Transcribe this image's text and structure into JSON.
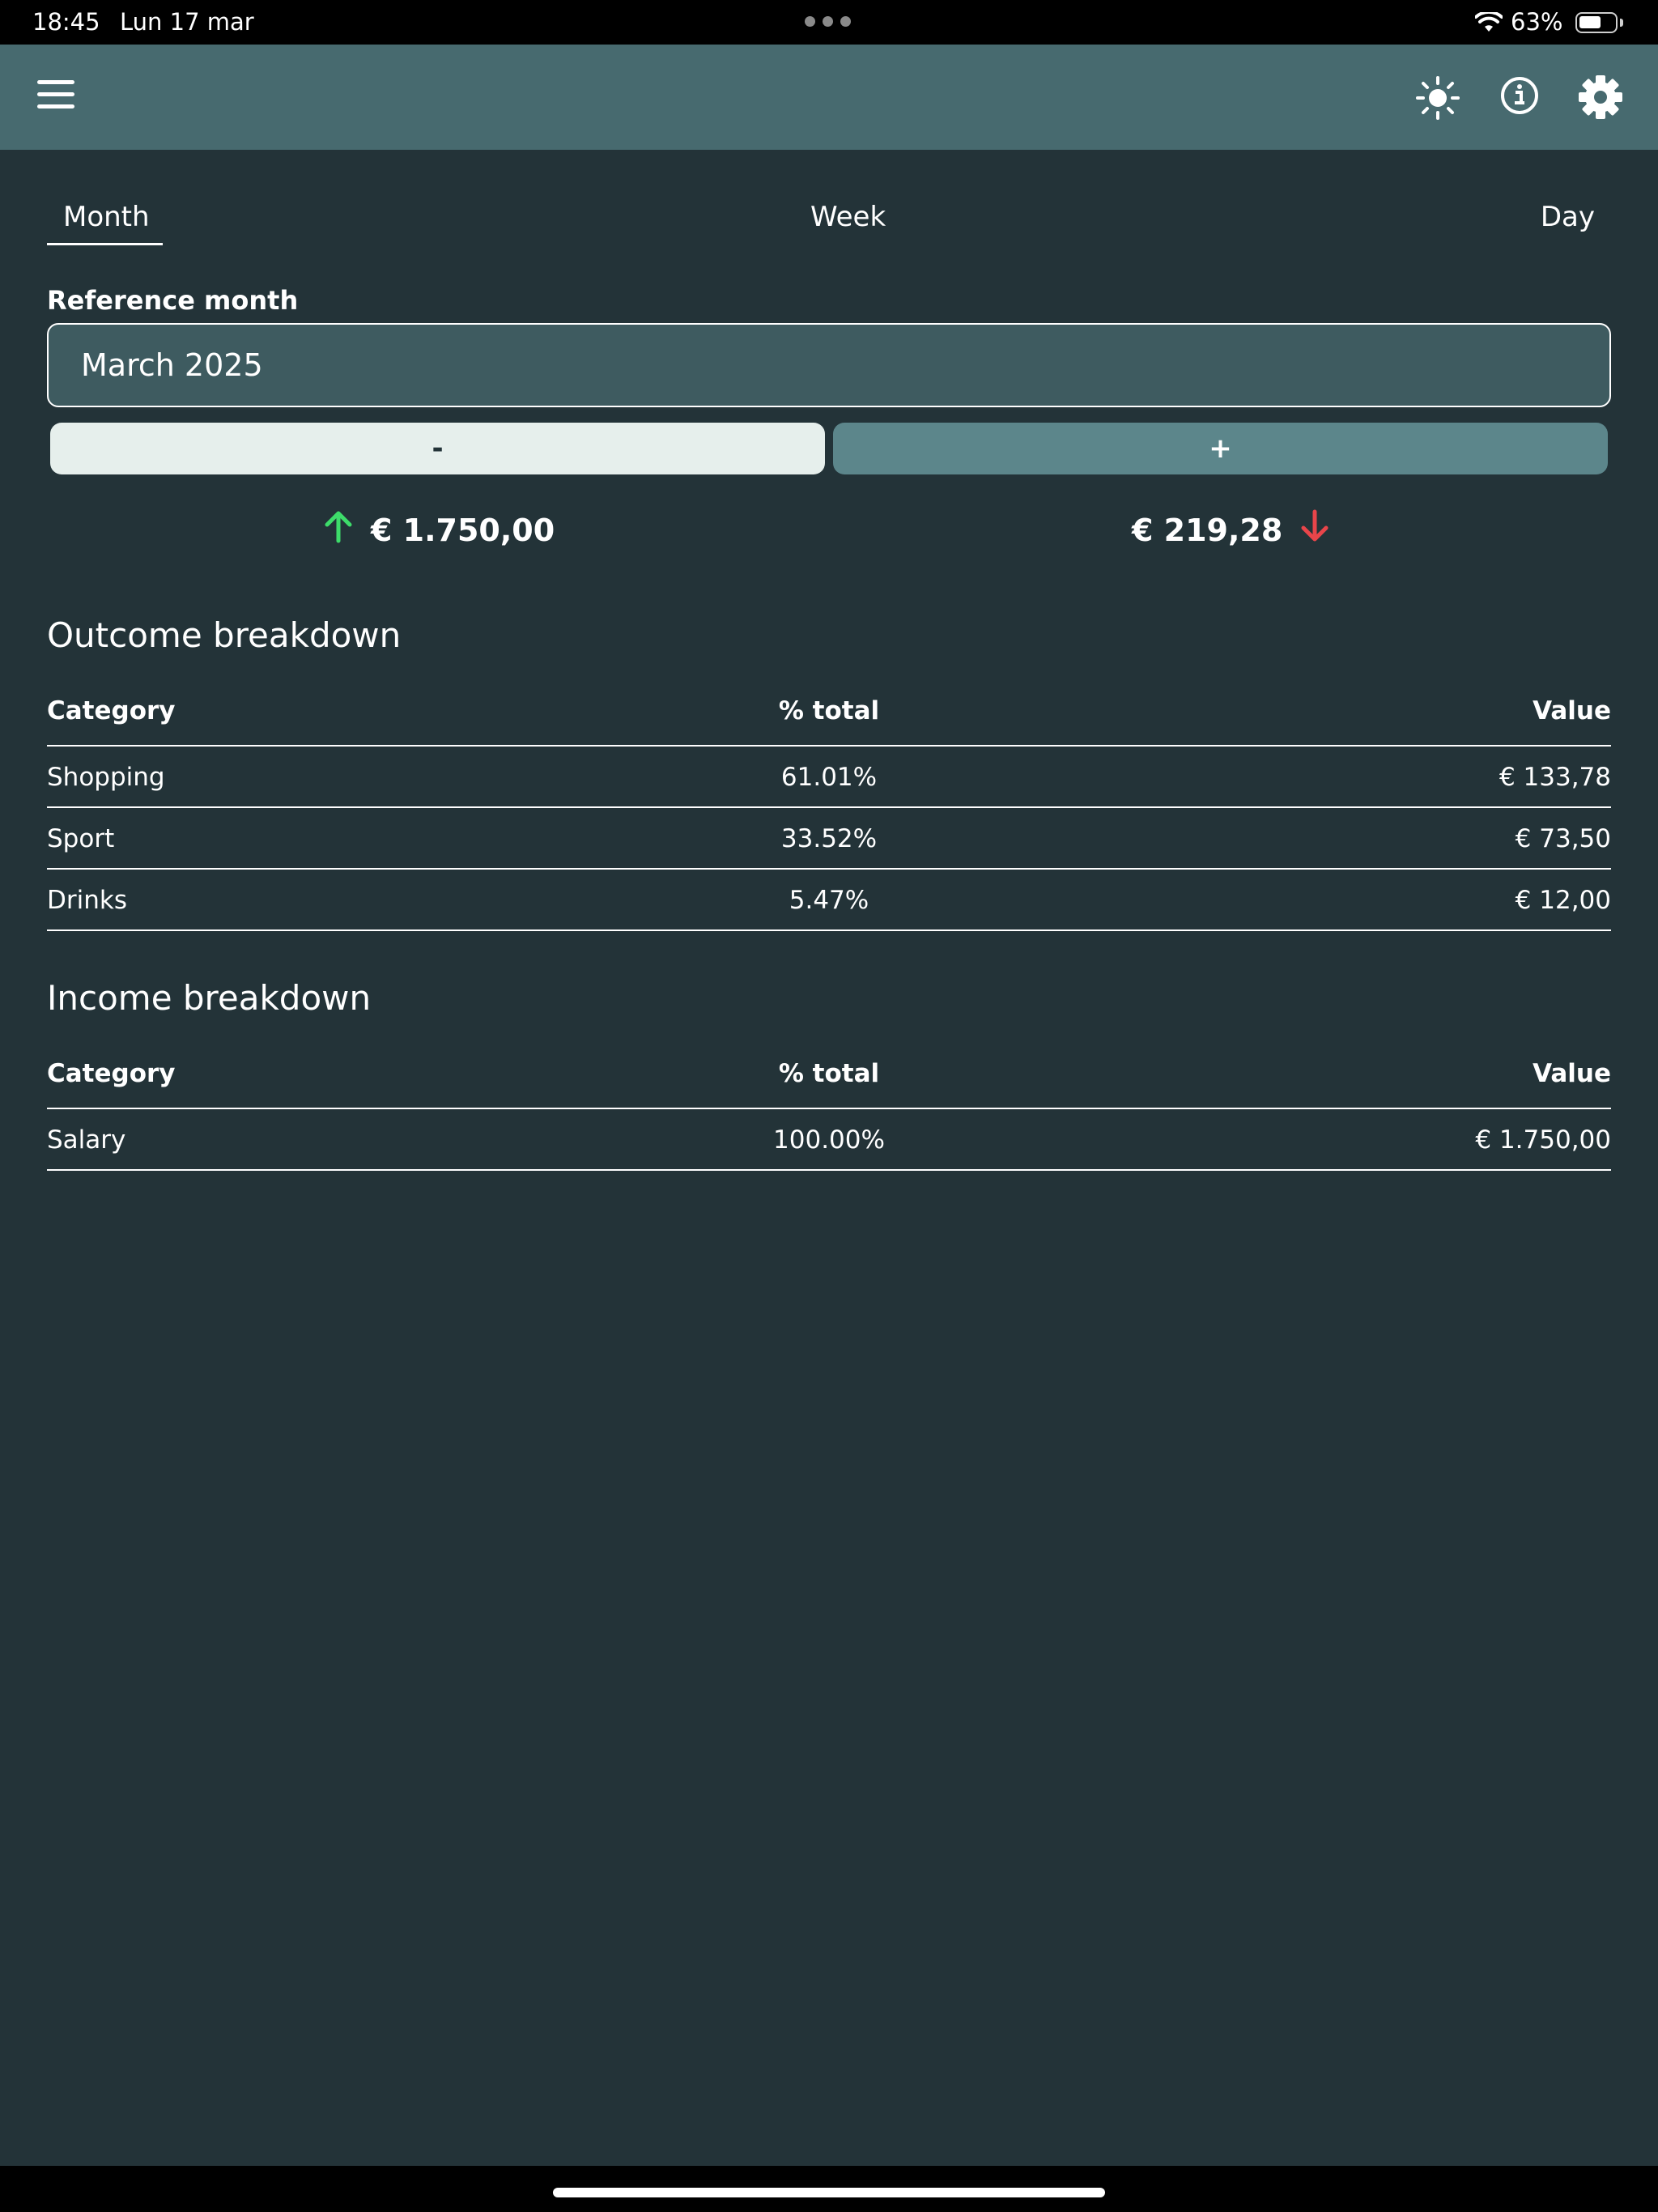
{
  "status_bar": {
    "time": "18:45",
    "date": "Lun 17 mar",
    "battery_percent": "63%",
    "battery_level": 0.63
  },
  "app_bar": {
    "icons": [
      "menu-icon",
      "sun-icon",
      "info-icon",
      "gear-icon"
    ]
  },
  "tabs": [
    {
      "label": "Month",
      "selected": true
    },
    {
      "label": "Week",
      "selected": false
    },
    {
      "label": "Day",
      "selected": false
    }
  ],
  "reference": {
    "label": "Reference month",
    "value": "March 2025"
  },
  "buttons": {
    "minus": "-",
    "plus": "+"
  },
  "summary": {
    "income": "€ 1.750,00",
    "outcome": "€ 219,28",
    "income_color": "#3ddc6a",
    "outcome_color": "#e8454a"
  },
  "outcome": {
    "title": "Outcome breakdown",
    "headers": [
      "Category",
      "% total",
      "Value"
    ],
    "rows": [
      {
        "category": "Shopping",
        "pct": "61.01%",
        "value": "€ 133,78"
      },
      {
        "category": "Sport",
        "pct": "33.52%",
        "value": "€ 73,50"
      },
      {
        "category": "Drinks",
        "pct": "5.47%",
        "value": "€ 12,00"
      }
    ]
  },
  "income": {
    "title": "Income breakdown",
    "headers": [
      "Category",
      "% total",
      "Value"
    ],
    "rows": [
      {
        "category": "Salary",
        "pct": "100.00%",
        "value": "€ 1.750,00"
      }
    ]
  },
  "colors": {
    "background": "#233338",
    "app_bar": "#476a6f",
    "input_bg": "#3e5b60",
    "minus_button": "#e6efec",
    "plus_button": "#5c868b"
  }
}
